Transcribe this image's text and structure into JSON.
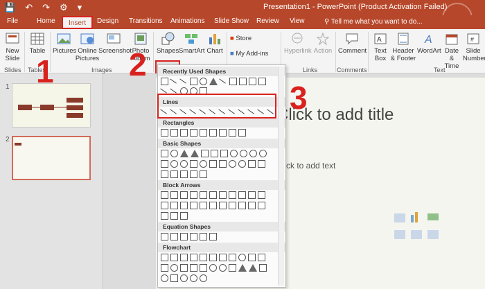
{
  "quick_access": {
    "save_icon": "save-icon",
    "undo_icon": "undo-icon",
    "redo_icon": "redo-icon",
    "present_icon": "present-icon"
  },
  "window_title": "Presentation1 - PowerPoint (Product Activation Failed)",
  "tabs": [
    "File",
    "Home",
    "Insert",
    "Design",
    "Transitions",
    "Animations",
    "Slide Show",
    "Review",
    "View"
  ],
  "active_tab": "Insert",
  "tell_me": "Tell me what you want to do...",
  "ribbon": {
    "new_slide": "New Slide",
    "table": "Table",
    "pictures": "Pictures",
    "online_pictures": "Online Pictures",
    "screenshot": "Screenshot",
    "photo_album": "Photo Album",
    "shapes": "Shapes",
    "smartart": "SmartArt",
    "chart": "Chart",
    "store": "Store",
    "my_addins": "My Add-ins",
    "hyperlink": "Hyperlink",
    "action": "Action",
    "comment": "Comment",
    "text_box": "Text Box",
    "header_footer": "Header & Footer",
    "wordart": "WordArt",
    "date_time": "Date & Time",
    "slide_number": "Slide Number",
    "group_slides": "Slides",
    "group_tables": "Tables",
    "group_images": "Images",
    "group_links": "Links",
    "group_comments": "Comments",
    "group_text": "Text"
  },
  "slides": {
    "numbers": [
      "1",
      "2"
    ]
  },
  "slide": {
    "title_placeholder": "Click to add title",
    "body_placeholder": "Click to add text"
  },
  "dropdown": {
    "sections": [
      "Recently Used Shapes",
      "Lines",
      "Rectangles",
      "Basic Shapes",
      "Block Arrows",
      "Equation Shapes",
      "Flowchart"
    ]
  },
  "steps": [
    "1",
    "2",
    "3"
  ],
  "colors": {
    "accent": "#b7472a",
    "highlight": "#d8221e"
  }
}
